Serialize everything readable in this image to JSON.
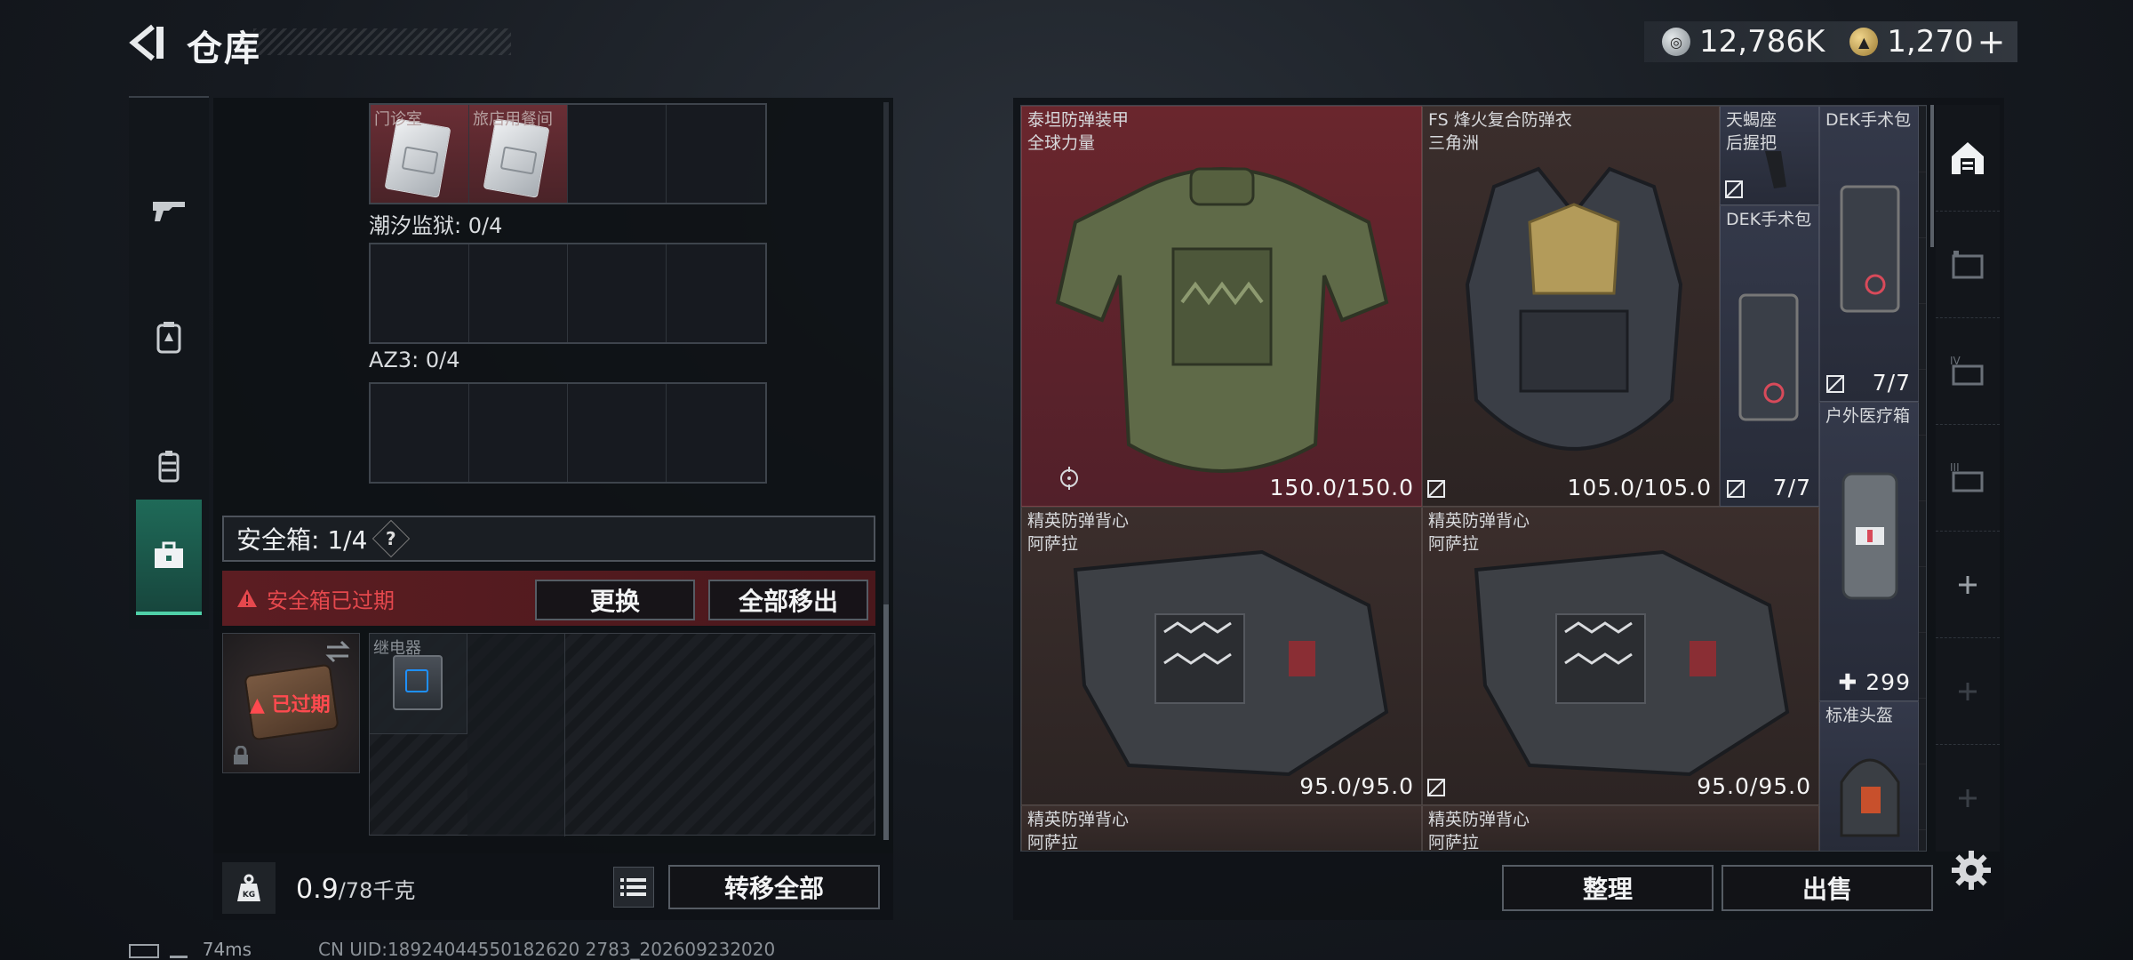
{
  "header": {
    "title": "仓库",
    "currency": [
      {
        "icon": "silver-coin-icon",
        "value": "12,786K"
      },
      {
        "icon": "gold-coin-icon",
        "value": "1,270"
      }
    ],
    "add_label": "+"
  },
  "left_tabs": [
    {
      "icon": "gun-icon",
      "active": false
    },
    {
      "icon": "backpack-icon",
      "active": false
    },
    {
      "icon": "vest-icon",
      "active": false
    },
    {
      "icon": "toolbox-icon",
      "active": true
    }
  ],
  "keycards": {
    "slots": [
      {
        "label": "门诊室",
        "filled": true
      },
      {
        "label": "旅店用餐间",
        "filled": true
      },
      {
        "label": "",
        "filled": false
      },
      {
        "label": "",
        "filled": false
      }
    ],
    "sections": [
      {
        "label": "潮汐监狱: 0/4"
      },
      {
        "label": "AZ3: 0/4"
      }
    ]
  },
  "safe": {
    "title": "安全箱: 1/4",
    "help": "?",
    "expired_message": "安全箱已过期",
    "replace_label": "更换",
    "remove_all_label": "全部移出",
    "box_status": "已过期",
    "item_label": "继电器"
  },
  "footer_left": {
    "weight": "0.9",
    "capacity": "/78千克",
    "transfer_all_label": "转移全部"
  },
  "status": {
    "ping": "74ms",
    "uid": "CN UID:18924044550182620 2783_202609232020"
  },
  "stash_items": [
    {
      "name": "泰坦防弹装甲",
      "sub": "全球力量",
      "value": "150.0/150.0"
    },
    {
      "name": "FS 烽火复合防弹衣",
      "sub": "三角洲",
      "value": "105.0/105.0"
    },
    {
      "name": "天蝎座",
      "sub": "后握把"
    },
    {
      "name": "DEK手术包",
      "value": "7/7"
    },
    {
      "name": "DEK手术包",
      "value": "7/7"
    },
    {
      "name": "户外医疗箱",
      "value": "299"
    },
    {
      "name": "精英防弹背心",
      "sub": "阿萨拉",
      "value": "95.0/95.0"
    },
    {
      "name": "精英防弹背心",
      "sub": "阿萨拉",
      "value": "95.0/95.0"
    },
    {
      "name": "标准头盔"
    },
    {
      "name": "精英防弹背心",
      "sub": "阿萨拉"
    },
    {
      "name": "精英防弹背心",
      "sub": "阿萨拉"
    }
  ],
  "footer_right": {
    "organize_label": "整理",
    "sell_label": "出售"
  },
  "colors": {
    "accent": "#4fd0a8",
    "danger": "#e5484d",
    "item_red": "#6a262d"
  }
}
